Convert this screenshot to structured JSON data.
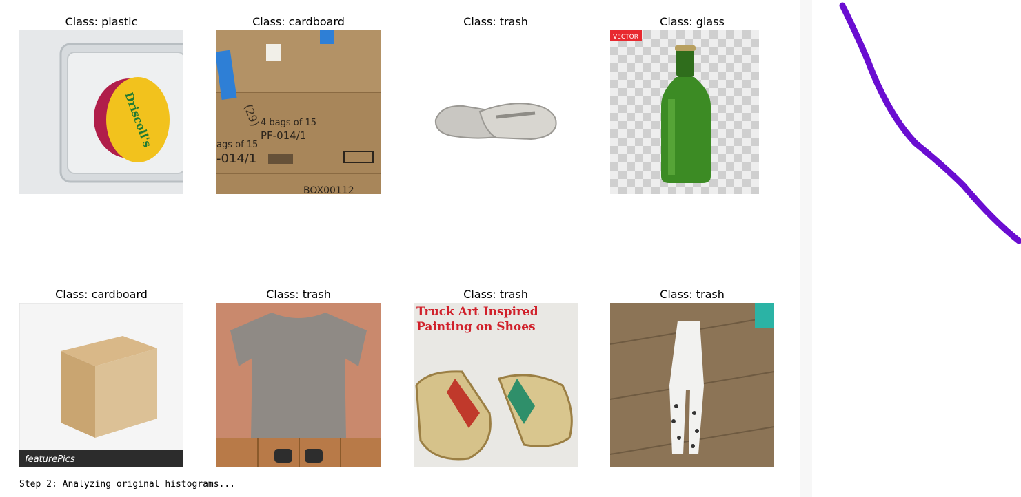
{
  "grid": {
    "cells": [
      {
        "label": "Class: plastic"
      },
      {
        "label": "Class: cardboard"
      },
      {
        "label": "Class: trash"
      },
      {
        "label": "Class: glass"
      },
      {
        "label": "Class: cardboard"
      },
      {
        "label": "Class: trash"
      },
      {
        "label": "Class: trash",
        "overlay_lines": [
          "Truck Art Inspired",
          "Painting on Shoes"
        ]
      },
      {
        "label": "Class: trash"
      }
    ]
  },
  "images": {
    "plastic_label": "Driscoll's",
    "cardboard_text_1": "4 bags of 15",
    "cardboard_text_2": "PF-014/1",
    "cardboard_text_3": "ags of 15",
    "cardboard_text_4": "-014/1",
    "cardboard_text_5": "BOX00112",
    "cardboard_text_6": "(29)",
    "glass_badge": "VECTOR",
    "box_brand": "featurePics"
  },
  "console": {
    "line": "Step 2: Analyzing original histograms..."
  },
  "colors": {
    "annotation_stroke": "#6a0dd1"
  }
}
